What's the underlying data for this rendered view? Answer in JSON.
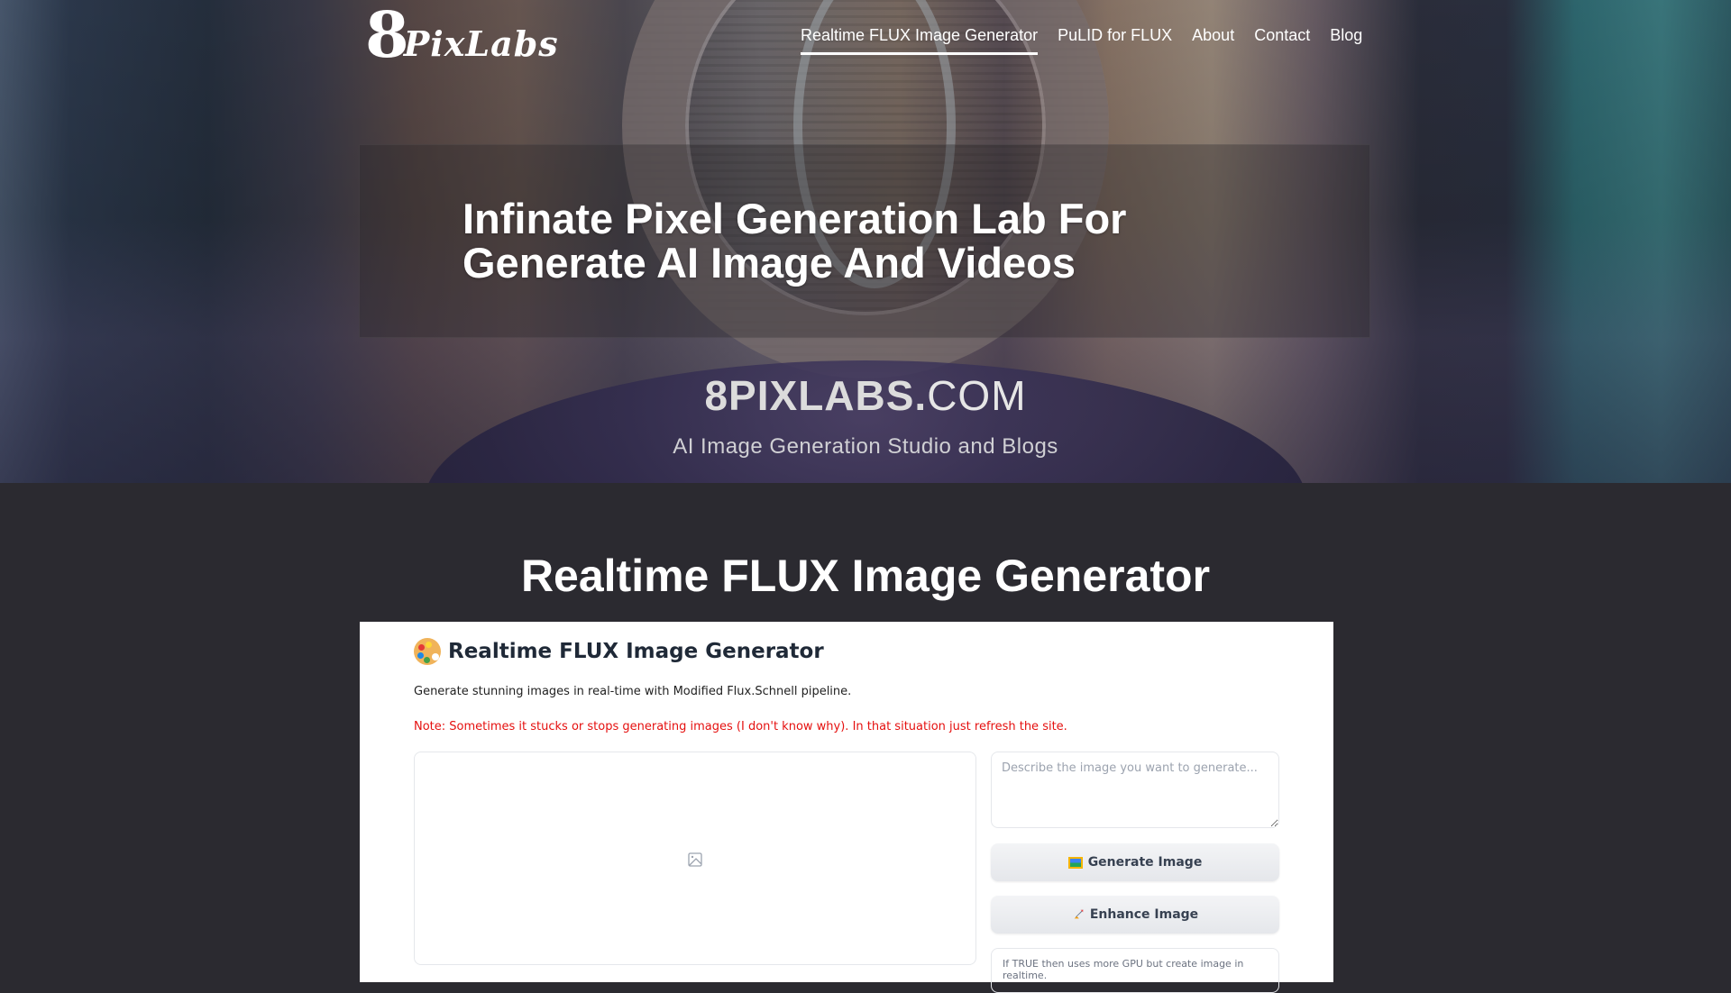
{
  "nav": {
    "logo_numeral": "8",
    "logo_text": "PixLabs",
    "links": [
      {
        "label": "Realtime FLUX Image Generator",
        "active": true
      },
      {
        "label": "PuLID for FLUX",
        "active": false
      },
      {
        "label": "About",
        "active": false
      },
      {
        "label": "Contact",
        "active": false
      },
      {
        "label": "Blog",
        "active": false
      }
    ]
  },
  "hero": {
    "title_line1": "Infinate Pixel Generation Lab For",
    "title_line2": "Generate AI Image And Videos",
    "brand_bold": "8PIXLABS.",
    "brand_light": "COM",
    "brand_tagline": "AI  Image Generation Studio and Blogs"
  },
  "section": {
    "title": "Realtime FLUX Image Generator"
  },
  "app": {
    "title_icon": "artist-palette-emoji",
    "title": "Realtime FLUX Image Generator",
    "description": "Generate stunning images in real-time with Modified Flux.Schnell pipeline.",
    "note": "Note: Sometimes it stucks or stops generating images (I don't know why). In that situation just refresh the site.",
    "image_placeholder_icon": "image-icon",
    "prompt_placeholder": "Describe the image you want to generate...",
    "prompt_value": "",
    "generate_button": {
      "icon": "framed-picture-emoji",
      "label": "Generate Image"
    },
    "enhance_button": {
      "icon": "rocket-emoji",
      "label": "Enhance Image"
    },
    "realtime_info": "If TRUE then uses more GPU but create image in realtime."
  },
  "colors": {
    "page_bg": "#2b2a30",
    "note_red": "#e5100f",
    "text_dark": "#1f2937",
    "button_bg": "#e5e7eb"
  }
}
